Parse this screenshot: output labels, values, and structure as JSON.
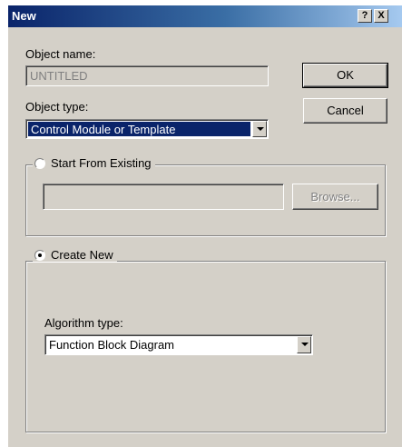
{
  "window": {
    "title": "New",
    "help_label": "?",
    "close_label": "X"
  },
  "object_name": {
    "label": "Object name:",
    "value": "UNTITLED"
  },
  "object_type": {
    "label": "Object type:",
    "selected": "Control Module or Template"
  },
  "buttons": {
    "ok": "OK",
    "cancel": "Cancel",
    "browse": "Browse..."
  },
  "start_from_existing": {
    "label": "Start From Existing",
    "selected": false,
    "path_value": ""
  },
  "create_new": {
    "label": "Create New",
    "selected": true
  },
  "algorithm_type": {
    "label": "Algorithm type:",
    "selected": "Function Block Diagram"
  },
  "colors": {
    "title_bar_start": "#0a246a",
    "title_bar_end": "#a6caf0",
    "dialog_face": "#d4d0c8",
    "selection_highlight": "#0a246a"
  }
}
